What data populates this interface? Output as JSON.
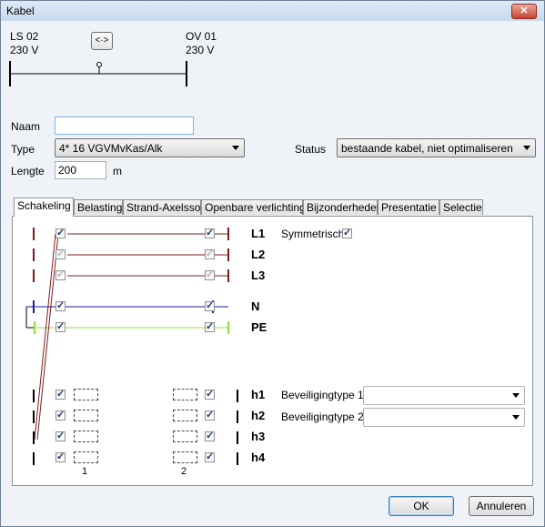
{
  "window": {
    "title": "Kabel"
  },
  "header": {
    "from_name": "LS 02",
    "from_voltage": "230 V",
    "to_name": "OV 01",
    "to_voltage": "230 V",
    "swap_label": "<·>"
  },
  "form": {
    "naam_label": "Naam",
    "naam_value": "",
    "type_label": "Type",
    "type_value": "4* 16 VGVMvKas/Alk",
    "status_label": "Status",
    "status_value": "bestaande kabel, niet optimaliseren",
    "lengte_label": "Lengte",
    "lengte_value": "200",
    "lengte_unit": "m"
  },
  "tabs": [
    "Schakeling",
    "Belasting",
    "Strand-Axelsson",
    "Openbare verlichting",
    "Bijzonderheden",
    "Presentatie",
    "Selectie"
  ],
  "schakeling": {
    "conductors": [
      "L1",
      "L2",
      "L3",
      "N",
      "PE"
    ],
    "symmetrisch_label": "Symmetrisch",
    "symmetrisch_checked": true,
    "protections": [
      "h1",
      "h2",
      "h3",
      "h4"
    ],
    "beveiliging1_label": "Beveiligingtype 1",
    "beveiliging1_value": "",
    "beveiliging2_label": "Beveiligingtype 2",
    "beveiliging2_value": "",
    "side1_label": "1",
    "side2_label": "2"
  },
  "colors": {
    "phase": "#7a1c1c",
    "neutral": "#1a1a9c",
    "earth": "#8fe03a"
  },
  "buttons": {
    "ok": "OK",
    "cancel": "Annuleren"
  }
}
